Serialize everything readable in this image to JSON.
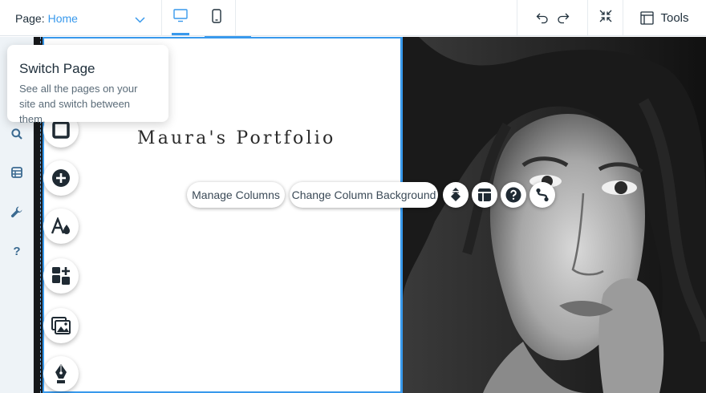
{
  "topbar": {
    "page_label": "Page:",
    "page_value": "Home",
    "tools_label": "Tools"
  },
  "tooltip": {
    "title": "Switch Page",
    "text": "See all the pages on your site and switch between them."
  },
  "site": {
    "title": "Maura's Portfolio"
  },
  "column_actions": {
    "manage_columns": "Manage Columns",
    "change_background": "Change Column Background"
  },
  "sidebar": {
    "help_glyph": "?"
  },
  "icons": {
    "page_dropdown": "chevron-down-icon",
    "desktop": "desktop-icon",
    "mobile": "mobile-icon",
    "undo": "undo-icon",
    "redo": "redo-icon",
    "zoom_out": "zoom-out-icon",
    "tools": "tools-icon"
  },
  "colors": {
    "accent": "#3899ec",
    "text": "#20303c",
    "sidebar": "#eef3f7"
  }
}
